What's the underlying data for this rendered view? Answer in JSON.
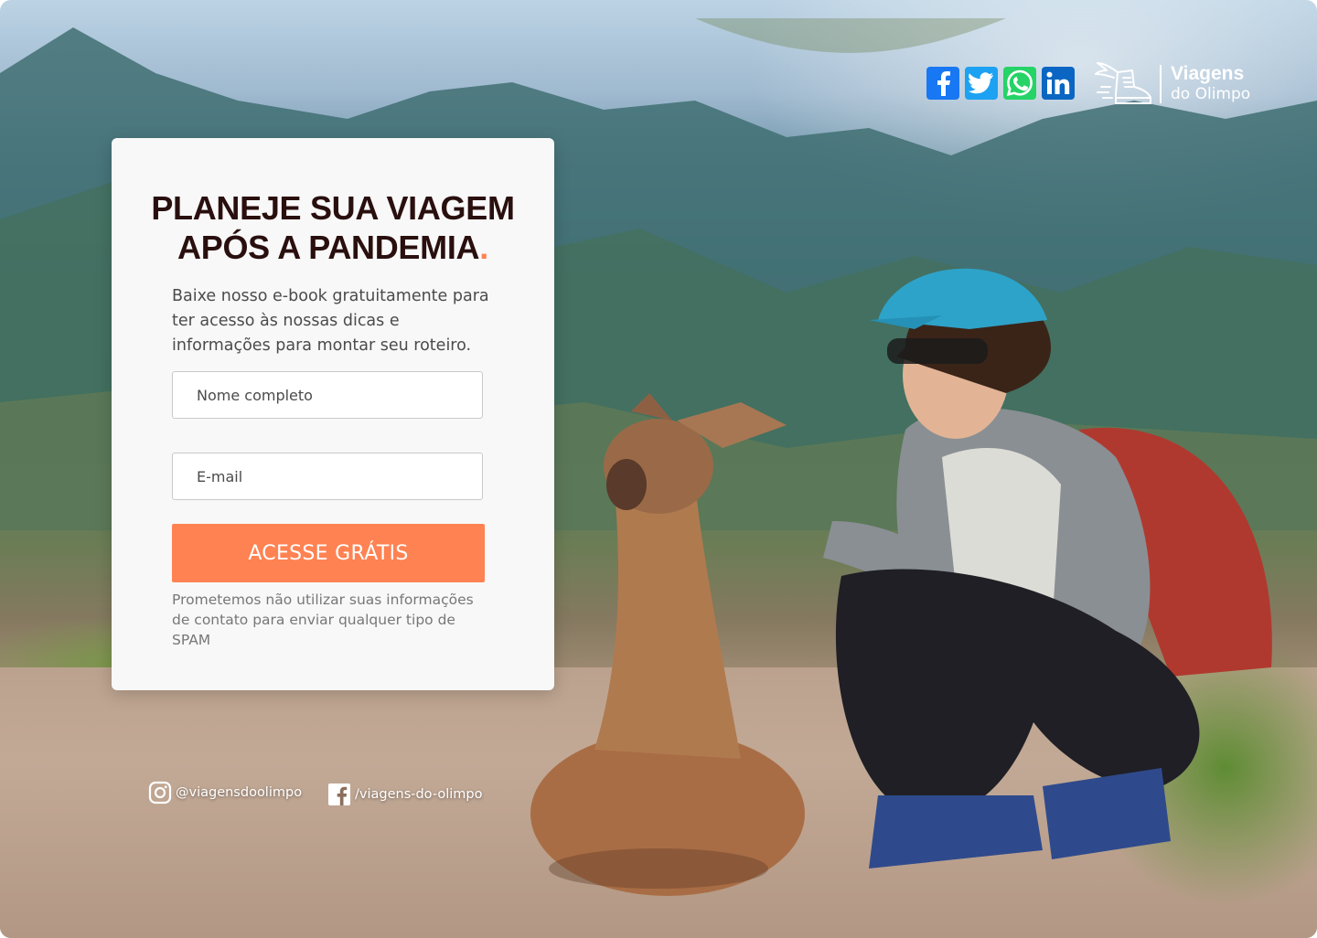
{
  "hero": {
    "title_line1": "PLANEJE SUA VIAGEM",
    "title_line2": "APÓS A PANDEMIA",
    "title_dot": ".",
    "description": "Baixe nosso e-book gratuitamente para ter acesso às nossas dicas e informações para montar seu roteiro."
  },
  "form": {
    "name_placeholder": "Nome completo",
    "email_placeholder": "E-mail",
    "submit_label": "ACESSE GRÁTIS",
    "disclaimer": "Prometemos não utilizar suas informações de contato para enviar qualquer tipo de SPAM"
  },
  "brand": {
    "name_line1": "Viagens",
    "name_line2": "do Olimpo",
    "icon": "winged-boot-icon"
  },
  "social_top": [
    {
      "name": "facebook",
      "icon": "facebook-icon",
      "color": "#1877f2"
    },
    {
      "name": "twitter",
      "icon": "twitter-icon",
      "color": "#1da1f2"
    },
    {
      "name": "whatsapp",
      "icon": "whatsapp-icon",
      "color": "#25d366"
    },
    {
      "name": "linkedin",
      "icon": "linkedin-icon",
      "color": "#0a66c2"
    }
  ],
  "social_footer": {
    "instagram_handle": "@viagensdoolimpo",
    "facebook_handle": "/viagens-do-olimpo"
  },
  "colors": {
    "accent": "#ff8252",
    "title": "#2a0f0f",
    "card_bg": "#f8f8f8"
  }
}
